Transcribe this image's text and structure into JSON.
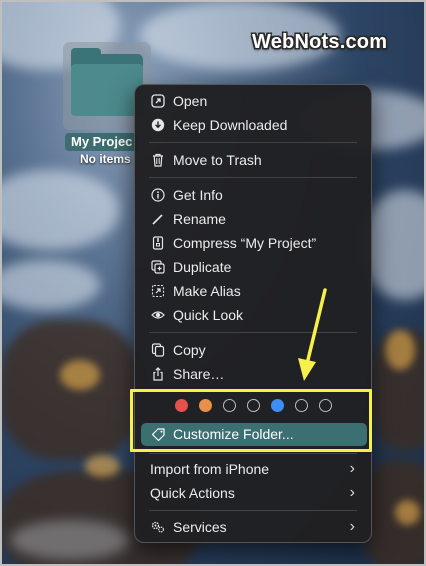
{
  "watermark": "WebNots.com",
  "desktop": {
    "folder_name": "My Project",
    "folder_name_visible": "My Projec",
    "folder_subtitle": "No items"
  },
  "menu": {
    "open": "Open",
    "keep_downloaded": "Keep Downloaded",
    "move_to_trash": "Move to Trash",
    "get_info": "Get Info",
    "rename": "Rename",
    "compress": "Compress “My Project”",
    "duplicate": "Duplicate",
    "make_alias": "Make Alias",
    "quick_look": "Quick Look",
    "copy": "Copy",
    "share": "Share…",
    "customize_folder": "Customize Folder...",
    "import_from_iphone": "Import from iPhone",
    "quick_actions": "Quick Actions",
    "services": "Services"
  },
  "tag_colors": [
    "#e5524d",
    "#e8904a",
    "none",
    "none",
    "#3f8ef6",
    "none",
    "none"
  ],
  "colors": {
    "highlight": "#3b6f72",
    "annotation": "#f5f04a",
    "folder": "#4c8a8e"
  }
}
